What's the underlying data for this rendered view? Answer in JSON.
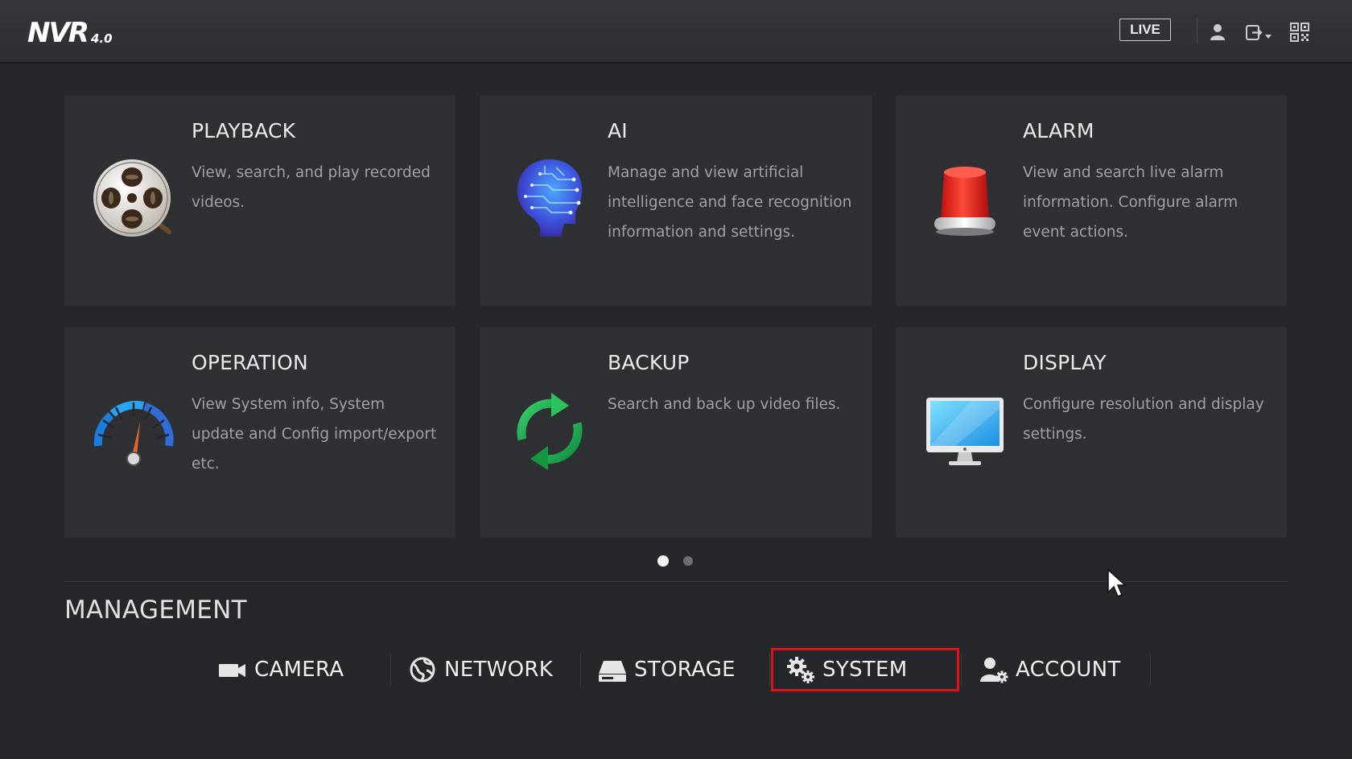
{
  "header": {
    "logo_main": "NVR",
    "logo_version": "4.0",
    "live_label": "LIVE",
    "icons": [
      "user-icon",
      "logout-icon",
      "qr-code-icon"
    ]
  },
  "cards": [
    {
      "title": "PLAYBACK",
      "description": "View, search, and play recorded videos.",
      "icon": "film-reel-icon"
    },
    {
      "title": "AI",
      "description": "Manage and view artificial intelligence and face recognition information and settings.",
      "icon": "ai-head-icon"
    },
    {
      "title": "ALARM",
      "description": "View and search live alarm information. Configure alarm event actions.",
      "icon": "alarm-siren-icon"
    },
    {
      "title": "OPERATION",
      "description": "View System info, System update and Config import/export etc.",
      "icon": "gauge-icon"
    },
    {
      "title": "BACKUP",
      "description": "Search and back up video files.",
      "icon": "refresh-arrows-icon"
    },
    {
      "title": "DISPLAY",
      "description": "Configure resolution and display settings.",
      "icon": "monitor-icon"
    }
  ],
  "pagination": {
    "pages": 2,
    "current": 1
  },
  "management": {
    "title": "MANAGEMENT",
    "items": [
      {
        "label": "CAMERA",
        "icon": "camera-icon"
      },
      {
        "label": "NETWORK",
        "icon": "network-globe-icon"
      },
      {
        "label": "STORAGE",
        "icon": "hard-drive-icon"
      },
      {
        "label": "SYSTEM",
        "icon": "gears-icon",
        "highlighted": true
      },
      {
        "label": "ACCOUNT",
        "icon": "user-gear-icon"
      }
    ]
  },
  "colors": {
    "background": "#25272b",
    "card": "#2f3034",
    "highlight_border": "#e2101a"
  }
}
